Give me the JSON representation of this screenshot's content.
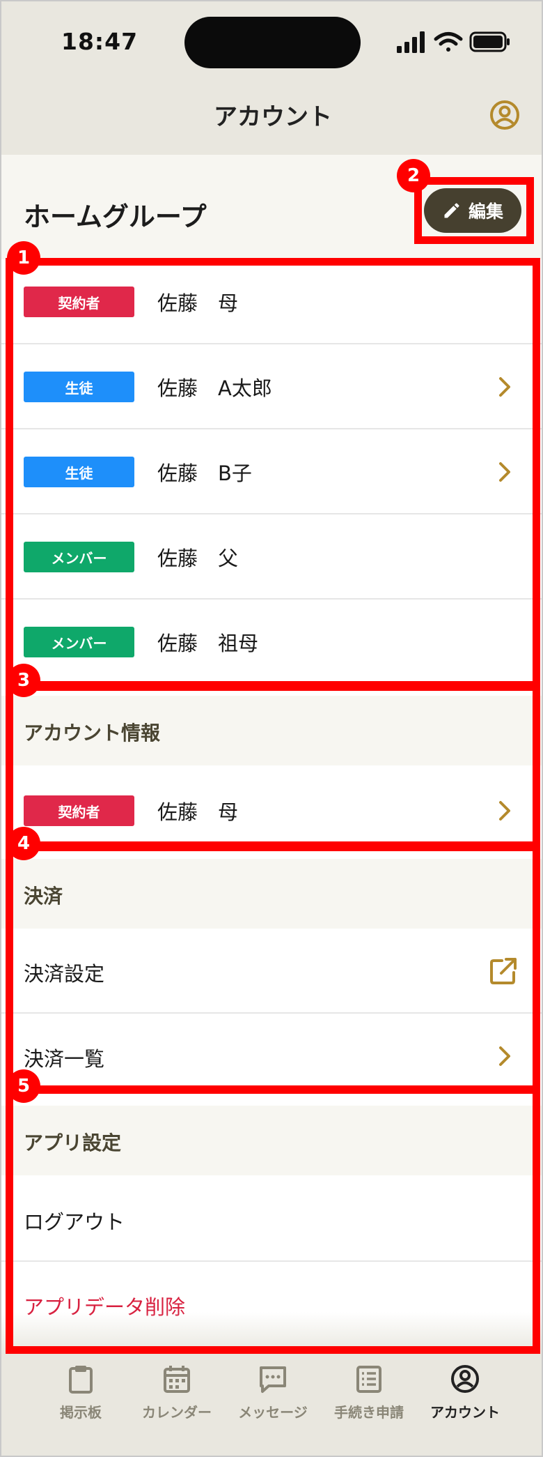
{
  "status": {
    "time": "18:47"
  },
  "header": {
    "title": "アカウント"
  },
  "home_group": {
    "title": "ホームグループ",
    "edit_label": "編集",
    "members": [
      {
        "role": "契約者",
        "name": "佐藤　母",
        "color": "#e0284a",
        "chevron": false
      },
      {
        "role": "生徒",
        "name": "佐藤　A太郎",
        "color": "#1e8ffa",
        "chevron": true
      },
      {
        "role": "生徒",
        "name": "佐藤　B子",
        "color": "#1e8ffa",
        "chevron": true
      },
      {
        "role": "メンバー",
        "name": "佐藤　父",
        "color": "#0fa86a",
        "chevron": false
      },
      {
        "role": "メンバー",
        "name": "佐藤　祖母",
        "color": "#0fa86a",
        "chevron": false
      }
    ]
  },
  "account_info": {
    "title": "アカウント情報",
    "row": {
      "role": "契約者",
      "name": "佐藤　母"
    }
  },
  "payment": {
    "title": "決済",
    "settings_label": "決済設定",
    "list_label": "決済一覧"
  },
  "app_settings": {
    "title": "アプリ設定",
    "logout_label": "ログアウト",
    "delete_label": "アプリデータ削除"
  },
  "annotations": [
    "1",
    "2",
    "3",
    "4",
    "5"
  ],
  "tabs": [
    {
      "label": "掲示板",
      "icon": "clipboard-icon"
    },
    {
      "label": "カレンダー",
      "icon": "calendar-icon"
    },
    {
      "label": "メッセージ",
      "icon": "message-icon"
    },
    {
      "label": "手続き申請",
      "icon": "form-icon"
    },
    {
      "label": "アカウント",
      "icon": "account-icon",
      "active": true
    }
  ],
  "colors": {
    "accent": "#b48a2c",
    "header_bg": "#e9e7df",
    "edit_button": "#46402f",
    "annotation": "#ff0000"
  }
}
